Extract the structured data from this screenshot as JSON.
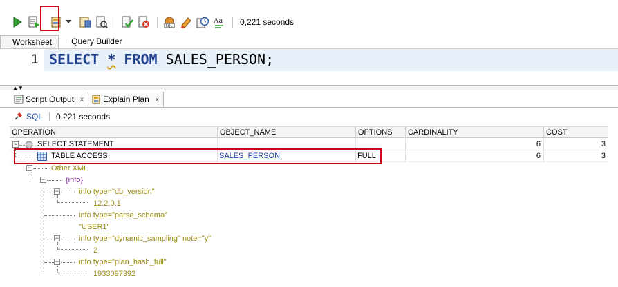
{
  "toolbar": {
    "elapsed": "0,221 seconds",
    "icons": [
      "run-statement-icon",
      "run-script-icon",
      "explain-plan-icon",
      "dropdown-arrow-icon",
      "autotrace-icon",
      "sql-tuning-icon",
      "commit-icon",
      "rollback-icon",
      "unshared-sql-icon",
      "clear-icon",
      "sql-history-icon",
      "format-text-icon"
    ]
  },
  "worksheet_tabs": [
    {
      "label": "Worksheet",
      "active": true
    },
    {
      "label": "Query Builder",
      "active": false
    }
  ],
  "editor": {
    "line_number": "1",
    "tokens": [
      "SELECT",
      "*",
      "FROM",
      "SALES_PERSON;"
    ]
  },
  "output_tabs": [
    {
      "label": "Script Output",
      "close": "x",
      "active": false
    },
    {
      "label": "Explain Plan",
      "close": "x",
      "active": true
    }
  ],
  "sqlbar": {
    "sql_link": "SQL",
    "elapsed": "0,221 seconds"
  },
  "plan": {
    "columns": [
      "OPERATION",
      "OBJECT_NAME",
      "OPTIONS",
      "CARDINALITY",
      "COST"
    ],
    "rows": [
      {
        "operation": "SELECT STATEMENT",
        "object_name": "",
        "options": "",
        "cardinality": "6",
        "cost": "3"
      },
      {
        "operation": "TABLE ACCESS",
        "object_name": "SALES_PERSON",
        "options": "FULL",
        "cardinality": "6",
        "cost": "3"
      }
    ],
    "other_xml": {
      "label": "Other XML",
      "root": "{info}",
      "entries": [
        {
          "key": "info type=\"db_version\"",
          "value": "12.2.0.1"
        },
        {
          "key": "info type=\"parse_schema\"",
          "value": "\"USER1\""
        },
        {
          "key": "info type=\"dynamic_sampling\" note=\"y\"",
          "value": "2"
        },
        {
          "key": "info type=\"plan_hash_full\"",
          "value": "1933097392"
        }
      ]
    }
  },
  "colors": {
    "highlight": "#d0021b",
    "keyword": "#1f3f8e",
    "xml_text": "#9a8a10",
    "xml_root": "#7a2c96",
    "link": "#1a3fa0"
  }
}
